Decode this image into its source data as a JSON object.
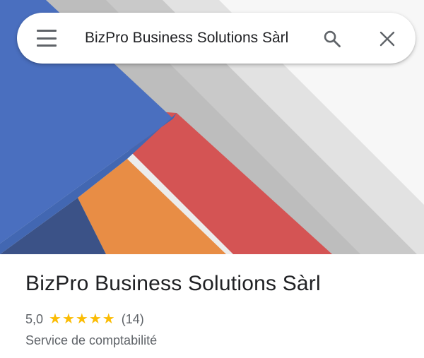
{
  "search": {
    "query": "BizPro Business Solutions Sàrl"
  },
  "place": {
    "name": "BizPro Business Solutions Sàrl",
    "rating": "5,0",
    "stars": 5,
    "review_count": "(14)",
    "category": "Service de comptabilité"
  },
  "colors": {
    "blue": "#4a6fbf",
    "navy": "#3b5287",
    "red": "#d45454",
    "orange": "#e88d45",
    "gray": "#c6c6c6",
    "light_gray": "#e4e4e4",
    "star": "#fbbc04"
  },
  "icons": {
    "menu": "hamburger-menu-icon",
    "search": "magnifier-icon",
    "close": "x-close-icon",
    "star": "star-icon"
  }
}
